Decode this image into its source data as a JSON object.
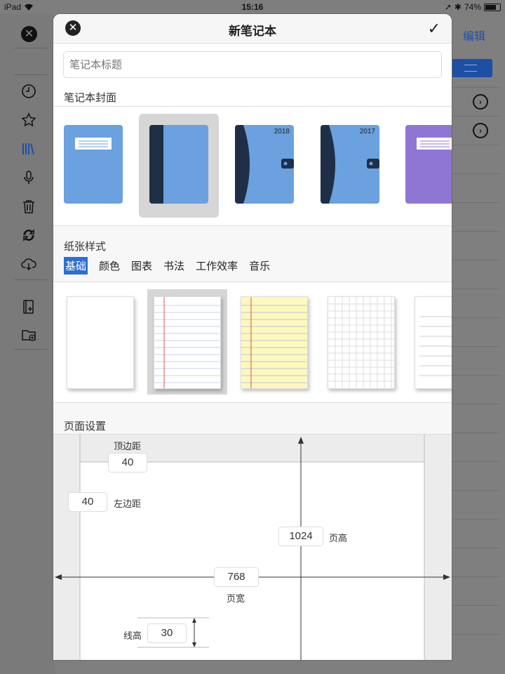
{
  "status_bar": {
    "device": "iPad",
    "time": "15:16",
    "battery": "74%",
    "battery_level": 0.74
  },
  "background": {
    "edit_label": "编辑"
  },
  "modal": {
    "title": "新笔记本",
    "title_input_placeholder": "笔记本标题",
    "cover_section_label": "笔记本封面",
    "covers": [
      {
        "name": "blue-label",
        "year": ""
      },
      {
        "name": "blue-spine",
        "year": ""
      },
      {
        "name": "blue-planner",
        "year": "2018"
      },
      {
        "name": "blue-planner",
        "year": "2017"
      },
      {
        "name": "purple-label",
        "year": ""
      }
    ],
    "selected_cover_index": 1,
    "paper_section_label": "纸张样式",
    "paper_tabs": [
      "基础",
      "颜色",
      "图表",
      "书法",
      "工作效率",
      "音乐"
    ],
    "active_paper_tab": "基础",
    "papers": [
      "blank",
      "ruled-margin",
      "yellow-legal",
      "grid",
      "lined"
    ],
    "selected_paper_index": 1,
    "page_settings_label": "页面设置",
    "page_settings": {
      "top_margin_label": "顶边距",
      "top_margin": "40",
      "left_margin_label": "左边距",
      "left_margin": "40",
      "page_height_label": "页高",
      "page_height": "1024",
      "page_width_label": "页宽",
      "page_width": "768",
      "line_height_label": "线高",
      "line_height": "30"
    }
  },
  "colors": {
    "accent": "#2d6fd4",
    "cover_blue": "#6aa1de",
    "cover_dark": "#1f2f47",
    "cover_purple": "#8f76d4",
    "legal_yellow": "#fdf8bd"
  }
}
